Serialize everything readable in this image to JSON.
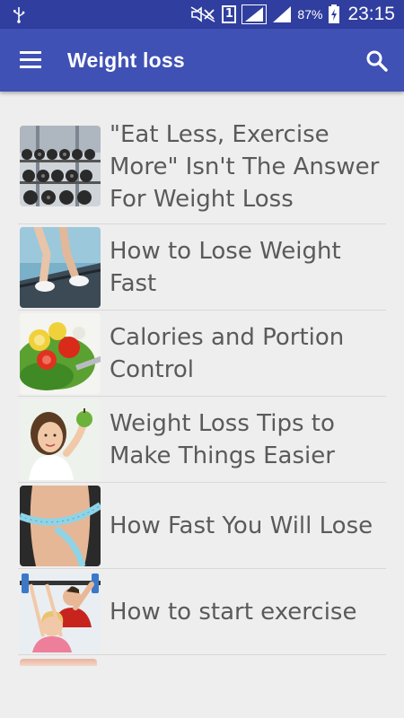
{
  "status_bar": {
    "battery_percent": "87%",
    "time": "23:15",
    "sim_slot": "1",
    "icons": [
      "usb-icon",
      "mute-icon",
      "signal-icon",
      "battery-charging-icon"
    ]
  },
  "app_bar": {
    "title": "Weight loss",
    "menu_icon": "hamburger-menu-icon",
    "search_icon": "search-icon",
    "color": "#3f51b5",
    "status_color": "#303f9f"
  },
  "articles": [
    {
      "title": "\"Eat Less, Exercise More\" Isn't The Answer For Weight Loss",
      "image": "dumbbell-rack"
    },
    {
      "title": "How to Lose Weight Fast",
      "image": "treadmill-runner"
    },
    {
      "title": "Calories and Portion Control",
      "image": "vegetable-salad"
    },
    {
      "title": "Weight Loss Tips to Make Things Easier",
      "image": "woman-with-apple"
    },
    {
      "title": "How Fast You Will Lose",
      "image": "waist-measuring-tape"
    },
    {
      "title": "How to start exercise",
      "image": "trainer-barbell"
    }
  ]
}
